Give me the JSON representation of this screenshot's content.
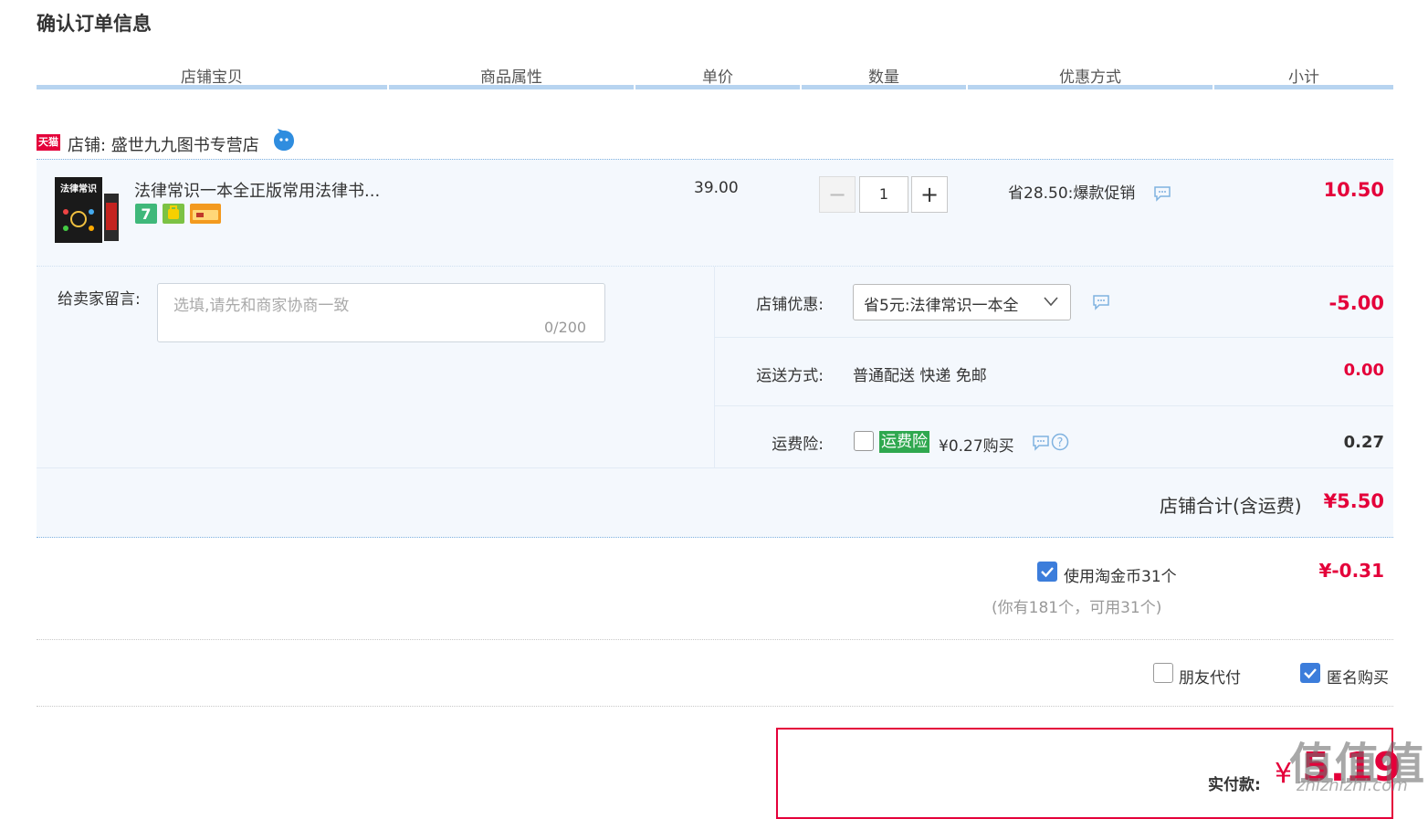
{
  "page": {
    "title": "确认订单信息"
  },
  "columns": [
    "店铺宝贝",
    "商品属性",
    "单价",
    "数量",
    "优惠方式",
    "小计"
  ],
  "shop": {
    "badge": "天猫",
    "name": "店铺: 盛世九九图书专营店"
  },
  "item": {
    "title": "法律常识一本全正版常用法律书...",
    "cover_title": "法律常识",
    "unit_price": "39.00",
    "quantity": "1",
    "promo": "省28.50:爆款促销",
    "subtotal": "10.50",
    "service_icons": [
      "seven-day-return-icon",
      "guarantee-icon",
      "credit-card-icon"
    ]
  },
  "message": {
    "label": "给卖家留言:",
    "placeholder": "选填,请先和商家协商一致",
    "count": "0/200"
  },
  "shop_discount": {
    "label": "店铺优惠:",
    "selected": "省5元:法律常识一本全",
    "amount": "-5.00"
  },
  "shipping": {
    "label": "运送方式:",
    "value": "普通配送 快递 免邮",
    "amount": "0.00"
  },
  "insurance": {
    "label": "运费险:",
    "tag": "运费险",
    "price": "¥0.27购买",
    "amount": "0.27",
    "checked": false
  },
  "shop_total": {
    "label": "店铺合计(含运费)",
    "value": "¥5.50"
  },
  "coins": {
    "label": "使用淘金币31个",
    "note": "(你有181个，可用31个)",
    "amount": "¥-0.31",
    "checked": true
  },
  "options": {
    "friend_pay": "朋友代付",
    "friend_checked": false,
    "anonymous": "匿名购买",
    "anonymous_checked": true
  },
  "payment": {
    "label": "实付款:",
    "currency": "¥",
    "amount": "5.19"
  },
  "watermark": {
    "logo": "值值值",
    "text": "zhizhizhi.com"
  },
  "colors": {
    "accent_red": "#e4003a",
    "header_bar": "#b7d4f0",
    "panel_bg": "#f4f8fd",
    "checkbox_blue": "#3c7ddb",
    "insurance_green": "#2fa84f"
  }
}
